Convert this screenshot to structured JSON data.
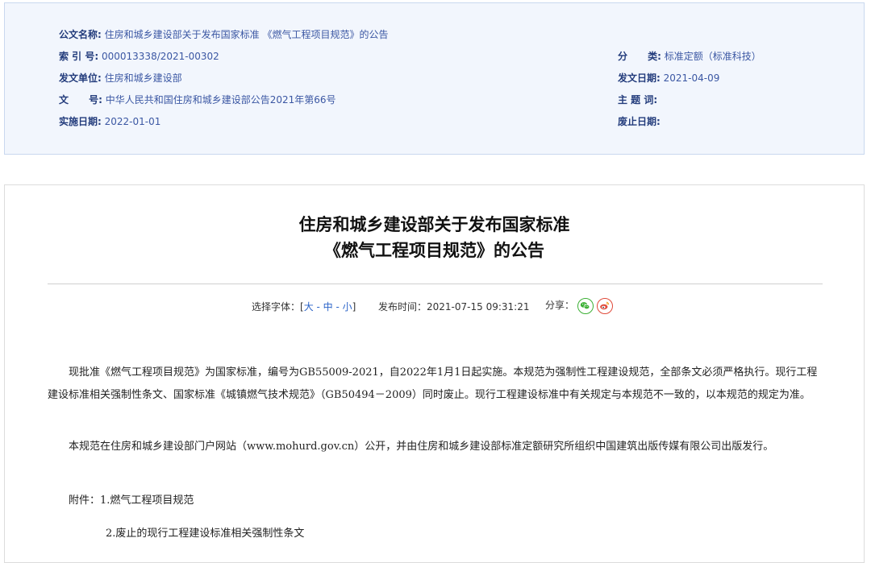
{
  "meta": {
    "title_label": "公文名称:",
    "title_value": "住房和城乡建设部关于发布国家标准 《燃气工程项目规范》的公告",
    "index_label": "索 引 号:",
    "index_value": "000013338/2021-00302",
    "category_label": "分      类:",
    "category_value": "标准定额（标准科技）",
    "issuer_label": "发文单位:",
    "issuer_value": "住房和城乡建设部",
    "date_label": "发文日期:",
    "date_value": "2021-04-09",
    "docno_label": "文      号:",
    "docno_value": "中华人民共和国住房和城乡建设部公告2021年第66号",
    "keywords_label": "主 题 词:",
    "keywords_value": "",
    "effective_label": "实施日期:",
    "effective_value": "2022-01-01",
    "repeal_label": "废止日期:",
    "repeal_value": ""
  },
  "article": {
    "title_line1": "住房和城乡建设部关于发布国家标准",
    "title_line2": "《燃气工程项目规范》的公告",
    "font_label": "选择字体：[",
    "font_large": "大",
    "font_sep1": " - ",
    "font_medium": "中",
    "font_sep2": " - ",
    "font_small": "小",
    "font_close": "]",
    "publish_label": "发布时间：",
    "publish_time": "2021-07-15 09:31:21",
    "share_label": "分享：",
    "para1": "现批准《燃气工程项目规范》为国家标准，编号为GB55009-2021，自2022年1月1日起实施。本规范为强制性工程建设规范，全部条文必须严格执行。现行工程建设标准相关强制性条文、国家标准《城镇燃气技术规范》（GB50494－2009）同时废止。现行工程建设标准中有关规定与本规范不一致的，以本规范的规定为准。",
    "para2": "本规范在住房和城乡建设部门户网站（www.mohurd.gov.cn）公开，并由住房和城乡建设部标准定额研究所组织中国建筑出版传媒有限公司出版发行。",
    "attach1": "附件：1.燃气工程项目规范",
    "attach2": "2.废止的现行工程建设标准相关强制性条文"
  },
  "colors": {
    "meta_bg": "#f2f6fd",
    "meta_label": "#233c7c",
    "meta_value": "#3b57a3",
    "link": "#2a63c8",
    "wechat": "#3cb035",
    "weibo": "#e04a3a"
  },
  "icons": [
    "wechat-icon",
    "weibo-icon"
  ]
}
